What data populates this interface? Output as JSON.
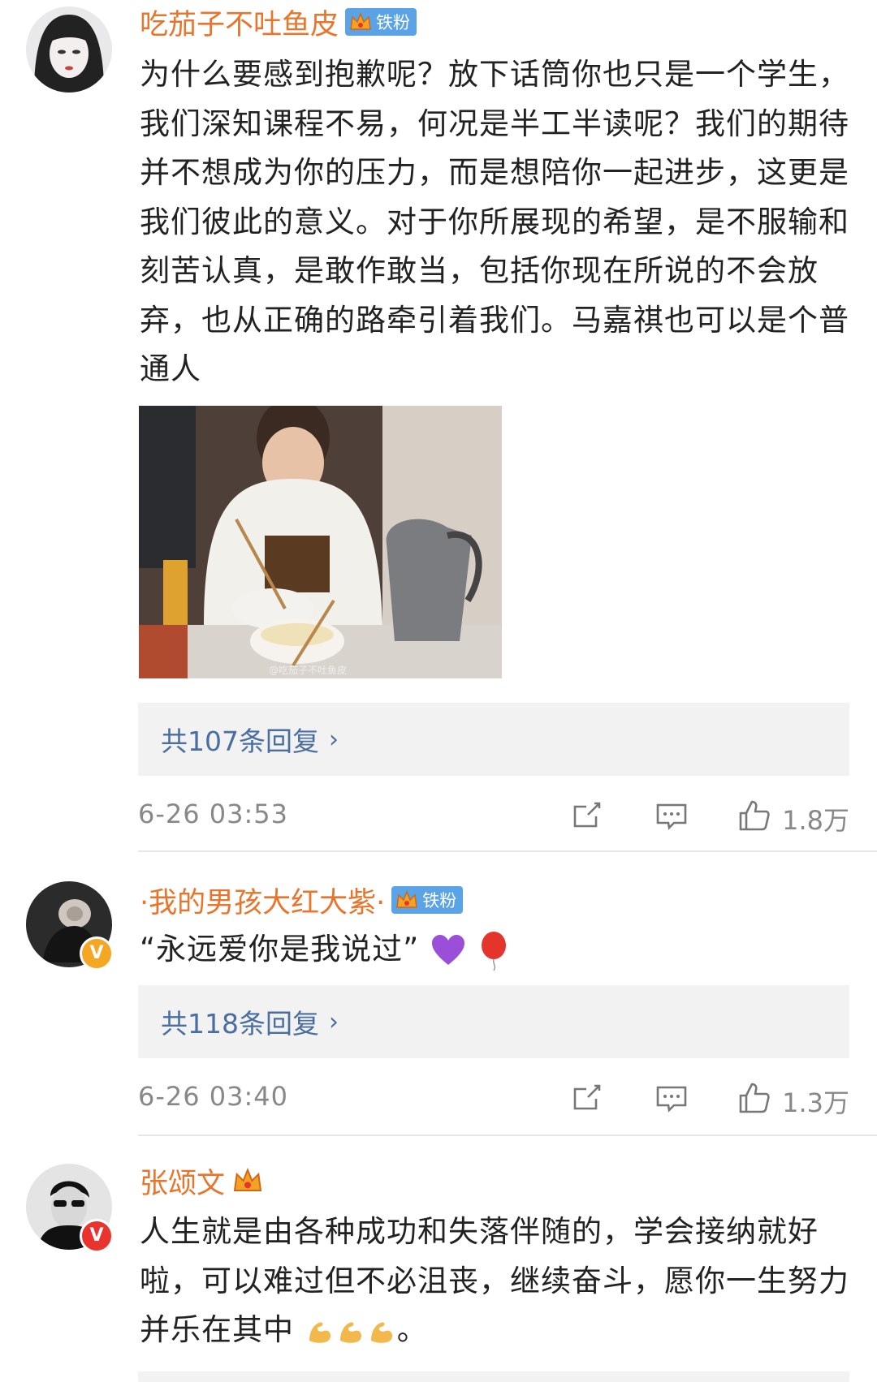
{
  "comments": [
    {
      "username": "吃茄子不吐鱼皮",
      "fan_badge": "铁粉",
      "text": "为什么要感到抱歉呢？放下话筒你也只是一个学生，我们深知课程不易，何况是半工半读呢？我们的期待并不想成为你的压力，而是想陪你一起进步，这更是我们彼此的意义。对于你所展现的希望，是不服输和刻苦认真，是敢作敢当，包括你现在所说的不会放弃，也从正确的路牵引着我们。马嘉祺也可以是个普通人",
      "image_watermark": "@吃茄子不吐鱼皮",
      "replies": "共107条回复",
      "time": "6-26 03:53",
      "likes": "1.8万"
    },
    {
      "username": "·我的男孩大红大紫·",
      "fan_badge": "铁粉",
      "text": "“永远爱你是我说过”",
      "replies": "共118条回复",
      "time": "6-26 03:40",
      "likes": "1.3万"
    },
    {
      "username": "张颂文",
      "text": "人生就是由各种成功和失落伴随的，学会接纳就好啦，可以难过但不必沮丧，继续奋斗，愿你一生努力并乐在其中",
      "text_end": "。"
    }
  ],
  "icons": {
    "reply_arrow": "›",
    "verified": "V"
  },
  "colors": {
    "username": "#e8752b",
    "link": "#4a6ea0",
    "badge": "#5aa3e6"
  }
}
